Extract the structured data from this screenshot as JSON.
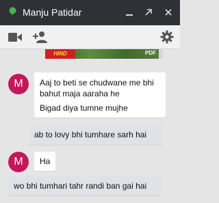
{
  "window": {
    "title": "Manju Patidar",
    "minimize_glyph": "▁",
    "popout_glyph": "↗",
    "close_glyph": "✕"
  },
  "toolbar": {
    "icons": [
      "video-call-icon",
      "add-person-icon",
      "settings-gear-icon"
    ]
  },
  "banner": {
    "left_text": "HIND",
    "right_text": "PDF"
  },
  "messages": [
    {
      "direction": "incoming",
      "avatar_letter": "M",
      "lines": [
        "Aaj to beti se chudwane me bhi bahut maja aaraha he",
        "Bigad diya tumne mujhe"
      ]
    },
    {
      "direction": "outgoing",
      "lines": [
        "ab to lovy bhi tumhare sarh hai"
      ]
    },
    {
      "direction": "incoming",
      "avatar_letter": "M",
      "lines": [
        "Ha"
      ]
    },
    {
      "direction": "outgoing",
      "lines": [
        "wo bhi tumhari tahr randi ban gai hai"
      ]
    }
  ],
  "colors": {
    "titlebar": "#2e3236",
    "avatar": "#c2185b",
    "outgoing_bubble": "#dfe3e7",
    "incoming_bubble": "#ffffff"
  }
}
